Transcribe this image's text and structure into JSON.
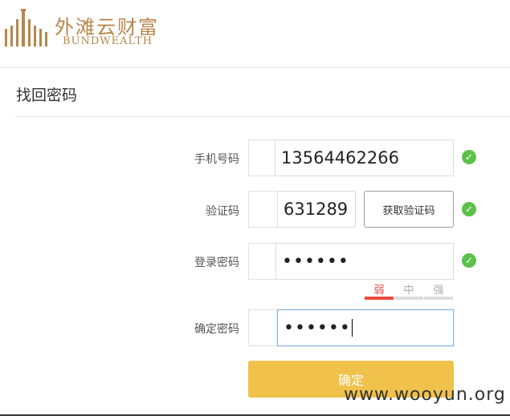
{
  "logo": {
    "name_cn": "外滩云财富",
    "name_en": "BUNDWEALTH"
  },
  "page": {
    "title": "找回密码"
  },
  "form": {
    "phone": {
      "label": "手机号码",
      "value": "13564462266"
    },
    "code": {
      "label": "验证码",
      "value": "631289",
      "button": "获取验证码"
    },
    "password": {
      "label": "登录密码",
      "value": "••••••"
    },
    "strength": {
      "weak": "弱",
      "medium": "中",
      "strong": "强",
      "level": "weak"
    },
    "confirm": {
      "label": "确定密码",
      "value": "••••••"
    },
    "submit": "确定"
  },
  "icons": {
    "valid": "check-circle-icon"
  },
  "colors": {
    "brand": "#b8864a",
    "button": "#f0c14b",
    "success": "#5cc14a",
    "weak": "#e84a3c"
  },
  "watermark": "www.wooyun.org"
}
